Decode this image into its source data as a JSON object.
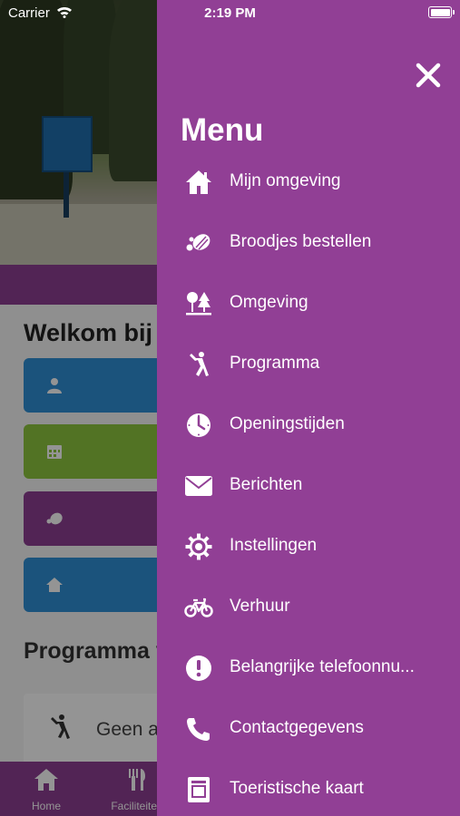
{
  "status_bar": {
    "carrier": "Carrier",
    "time": "2:19 PM"
  },
  "background": {
    "welcome_title": "Welkom bij C",
    "program_title": "Programma v",
    "program_item_text": "Geen a",
    "tab_bar": [
      {
        "label": "Home",
        "icon": "home-icon"
      },
      {
        "label": "Faciliteiten",
        "icon": "cutlery-icon"
      }
    ]
  },
  "menu": {
    "title": "Menu",
    "close_icon": "close-icon",
    "items": [
      {
        "label": "Mijn omgeving",
        "icon": "house-icon"
      },
      {
        "label": "Broodjes bestellen",
        "icon": "bread-icon"
      },
      {
        "label": "Omgeving",
        "icon": "trees-icon"
      },
      {
        "label": "Programma",
        "icon": "jumping-person-icon"
      },
      {
        "label": "Openingstijden",
        "icon": "clock-icon"
      },
      {
        "label": "Berichten",
        "icon": "envelope-icon"
      },
      {
        "label": "Instellingen",
        "icon": "gear-icon"
      },
      {
        "label": "Verhuur",
        "icon": "bicycle-icon"
      },
      {
        "label": "Belangrijke telefoonnu...",
        "icon": "exclamation-icon"
      },
      {
        "label": "Contactgegevens",
        "icon": "phone-icon"
      },
      {
        "label": "Toeristische kaart",
        "icon": "map-page-icon"
      }
    ]
  },
  "colors": {
    "drawer": "#913f95",
    "tile_blue": "#2f8fd6",
    "tile_green": "#8dc63f",
    "tile_purple": "#8e3f93",
    "tab_bar": "#8e3f93"
  }
}
